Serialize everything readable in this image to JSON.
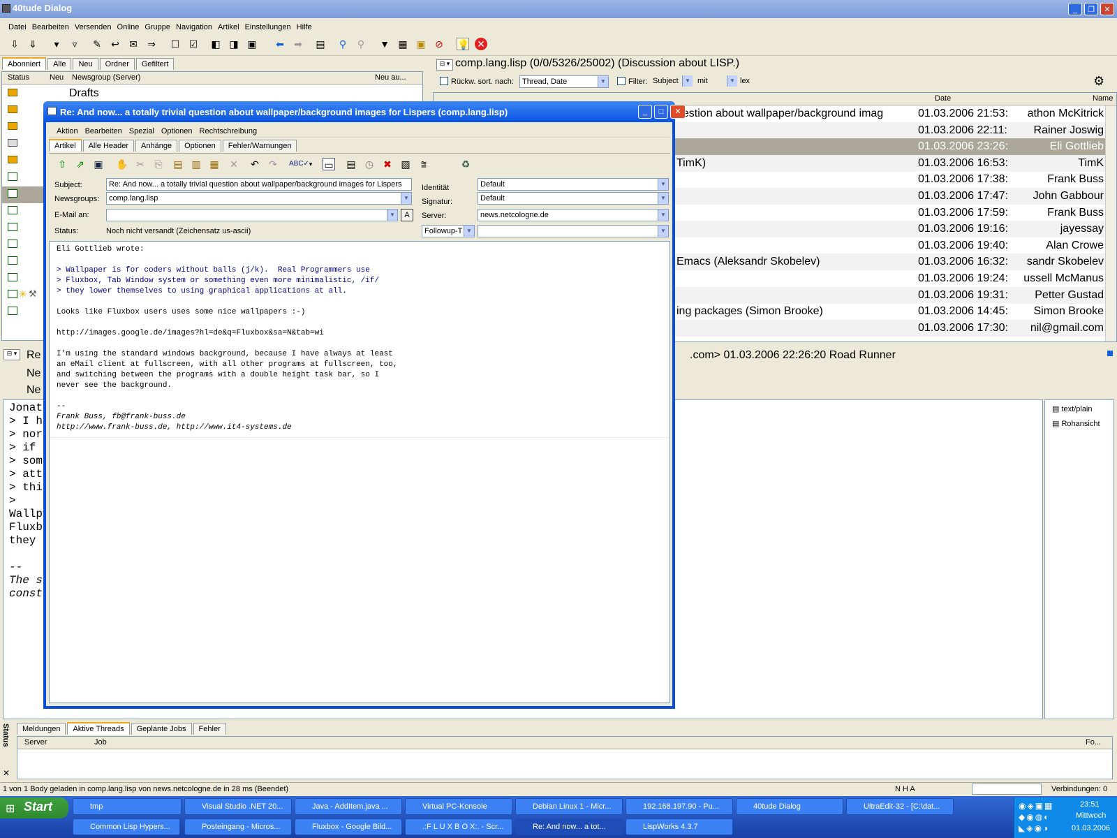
{
  "window": {
    "title": "40tude Dialog"
  },
  "menu": [
    "Datei",
    "Bearbeiten",
    "Versenden",
    "Online",
    "Gruppe",
    "Navigation",
    "Artikel",
    "Einstellungen",
    "Hilfe"
  ],
  "left_panel": {
    "tabs": [
      "Abonniert",
      "Alle",
      "Neu",
      "Ordner",
      "Gefiltert"
    ],
    "columns": [
      "Status",
      "Neu",
      "Newsgroup (Server)",
      "Neu au..."
    ],
    "first_item": "Drafts"
  },
  "group_header": {
    "title": "comp.lang.lisp (0/0/5326/25002) (Discussion about LISP.)",
    "sort_label": "Rückw. sort. nach:",
    "sort_value": "Thread, Date",
    "filter_label": "Filter:",
    "filter_field": "Subject",
    "filter_op": "mit",
    "filter_value": "lex",
    "col_date": "Date",
    "col_name": "Name"
  },
  "threads": [
    {
      "subject": "uestion about wallpaper/background imag",
      "date": "01.03.2006 21:53:",
      "name": "athon McKitrick"
    },
    {
      "subject": "",
      "date": "01.03.2006 22:11:",
      "name": "Rainer Joswig"
    },
    {
      "subject": "",
      "date": "01.03.2006 23:26:",
      "name": "Eli Gottlieb"
    },
    {
      "subject": "TimK)",
      "date": "01.03.2006 16:53:",
      "name": "TimK"
    },
    {
      "subject": "",
      "date": "01.03.2006 17:38:",
      "name": "Frank Buss"
    },
    {
      "subject": "",
      "date": "01.03.2006 17:47:",
      "name": "John Gabbour"
    },
    {
      "subject": "",
      "date": "01.03.2006 17:59:",
      "name": "Frank Buss"
    },
    {
      "subject": "",
      "date": "01.03.2006 19:16:",
      "name": "jayessay"
    },
    {
      "subject": "",
      "date": "01.03.2006 19:40:",
      "name": "Alan Crowe"
    },
    {
      "subject": "Emacs (Aleksandr Skobelev)",
      "date": "01.03.2006 16:32:",
      "name": "sandr Skobelev"
    },
    {
      "subject": "",
      "date": "01.03.2006 19:24:",
      "name": "ussell McManus"
    },
    {
      "subject": "",
      "date": "01.03.2006 19:31:",
      "name": "Petter Gustad"
    },
    {
      "subject": "ing packages (Simon Brooke)",
      "date": "01.03.2006 14:45:",
      "name": "Simon Brooke"
    },
    {
      "subject": "",
      "date": "01.03.2006 17:30:",
      "name": "nil@gmail.com"
    }
  ],
  "article_header": {
    "tail": ".com> 01.03.2006 22:26:20",
    "author": "Road Runner",
    "re": "Re",
    "ne1": "Ne",
    "ne2": "Ne"
  },
  "article_body_left": [
    "Jonat",
    "> I h",
    "> nor",
    "> if",
    "> som",
    "> att",
    "> thi",
    ">",
    "Wallp",
    "Fluxb",
    "they",
    "",
    "--",
    "The s",
    "const"
  ],
  "mime": {
    "item1": "text/plain",
    "item2": "Rohansicht"
  },
  "status_panel": {
    "label": "Status",
    "tabs": [
      "Meldungen",
      "Aktive Threads",
      "Geplante Jobs",
      "Fehler"
    ],
    "columns": [
      "Server",
      "Job",
      "Fo..."
    ]
  },
  "status_bar": {
    "text": "1 von 1 Body geladen in comp.lang.lisp von news.netcologne.de in 28 ms (Beendet)",
    "flags": "N  H  A",
    "connections": "Verbindungen: 0"
  },
  "dialog": {
    "title": "Re: And now... a totally trivial question about wallpaper/background images for Lispers (comp.lang.lisp)",
    "menu": [
      "Aktion",
      "Bearbeiten",
      "Spezial",
      "Optionen",
      "Rechtschreibung"
    ],
    "tabs": [
      "Artikel",
      "Alle Header",
      "Anhänge",
      "Optionen",
      "Fehler/Warnungen"
    ],
    "subject_label": "Subject:",
    "subject": "Re: And now... a totally trivial question about wallpaper/background images for Lispers",
    "newsgroups_label": "Newsgroups:",
    "newsgroups": "comp.lang.lisp",
    "email_label": "E-Mail an:",
    "email": "",
    "status_label": "Status:",
    "status": "Noch nicht versandt (Zeichensatz us-ascii)",
    "identity_label": "Identität",
    "identity": "Default",
    "signature_label": "Signatur:",
    "signature": "Default",
    "server_label": "Server:",
    "server": "news.netcologne.de",
    "followup": "Followup-T",
    "body_lines": [
      {
        "t": "Eli Gottlieb wrote:",
        "k": ""
      },
      {
        "t": "",
        "k": ""
      },
      {
        "t": "> Wallpaper is for coders without balls (j/k).  Real Programmers use",
        "k": "quote"
      },
      {
        "t": "> Fluxbox, Tab Window system or something even more minimalistic, /if/",
        "k": "quote"
      },
      {
        "t": "> they lower themselves to using graphical applications at all.",
        "k": "quote"
      },
      {
        "t": "",
        "k": ""
      },
      {
        "t": "Looks like Fluxbox users uses some nice wallpapers :-)",
        "k": ""
      },
      {
        "t": "",
        "k": ""
      },
      {
        "t": "http://images.google.de/images?hl=de&q=Fluxbox&sa=N&tab=wi",
        "k": ""
      },
      {
        "t": "",
        "k": ""
      },
      {
        "t": "I'm using the standard windows background, because I have always at least",
        "k": ""
      },
      {
        "t": "an eMail client at fullscreen, with all other programs at fullscreen, too,",
        "k": ""
      },
      {
        "t": "and switching between the programs with a double height task bar, so I",
        "k": ""
      },
      {
        "t": "never see the background.",
        "k": ""
      },
      {
        "t": "",
        "k": ""
      },
      {
        "t": "--",
        "k": ""
      },
      {
        "t": "Frank Buss, fb@frank-buss.de",
        "k": "sig"
      },
      {
        "t": "http://www.frank-buss.de, http://www.it4-systems.de",
        "k": "sig"
      }
    ]
  },
  "taskbar": {
    "start": "Start",
    "row1": [
      "tmp",
      "Visual Studio .NET 20...",
      "Java - AddItem.java ...",
      "Virtual PC-Konsole",
      "Debian Linux 1 - Micr...",
      "192.168.197.90 - Pu...",
      "40tude Dialog",
      "UltraEdit-32 - [C:\\dat..."
    ],
    "row2": [
      "Common Lisp Hypers...",
      "Posteingang - Micros...",
      "Fluxbox - Google Bild...",
      ".:F L U X B O X:. - Scr...",
      "Re: And now... a tot...",
      "LispWorks 4.3.7"
    ],
    "clock": "23:51",
    "day": "Mittwoch",
    "date": "01.03.2006"
  }
}
